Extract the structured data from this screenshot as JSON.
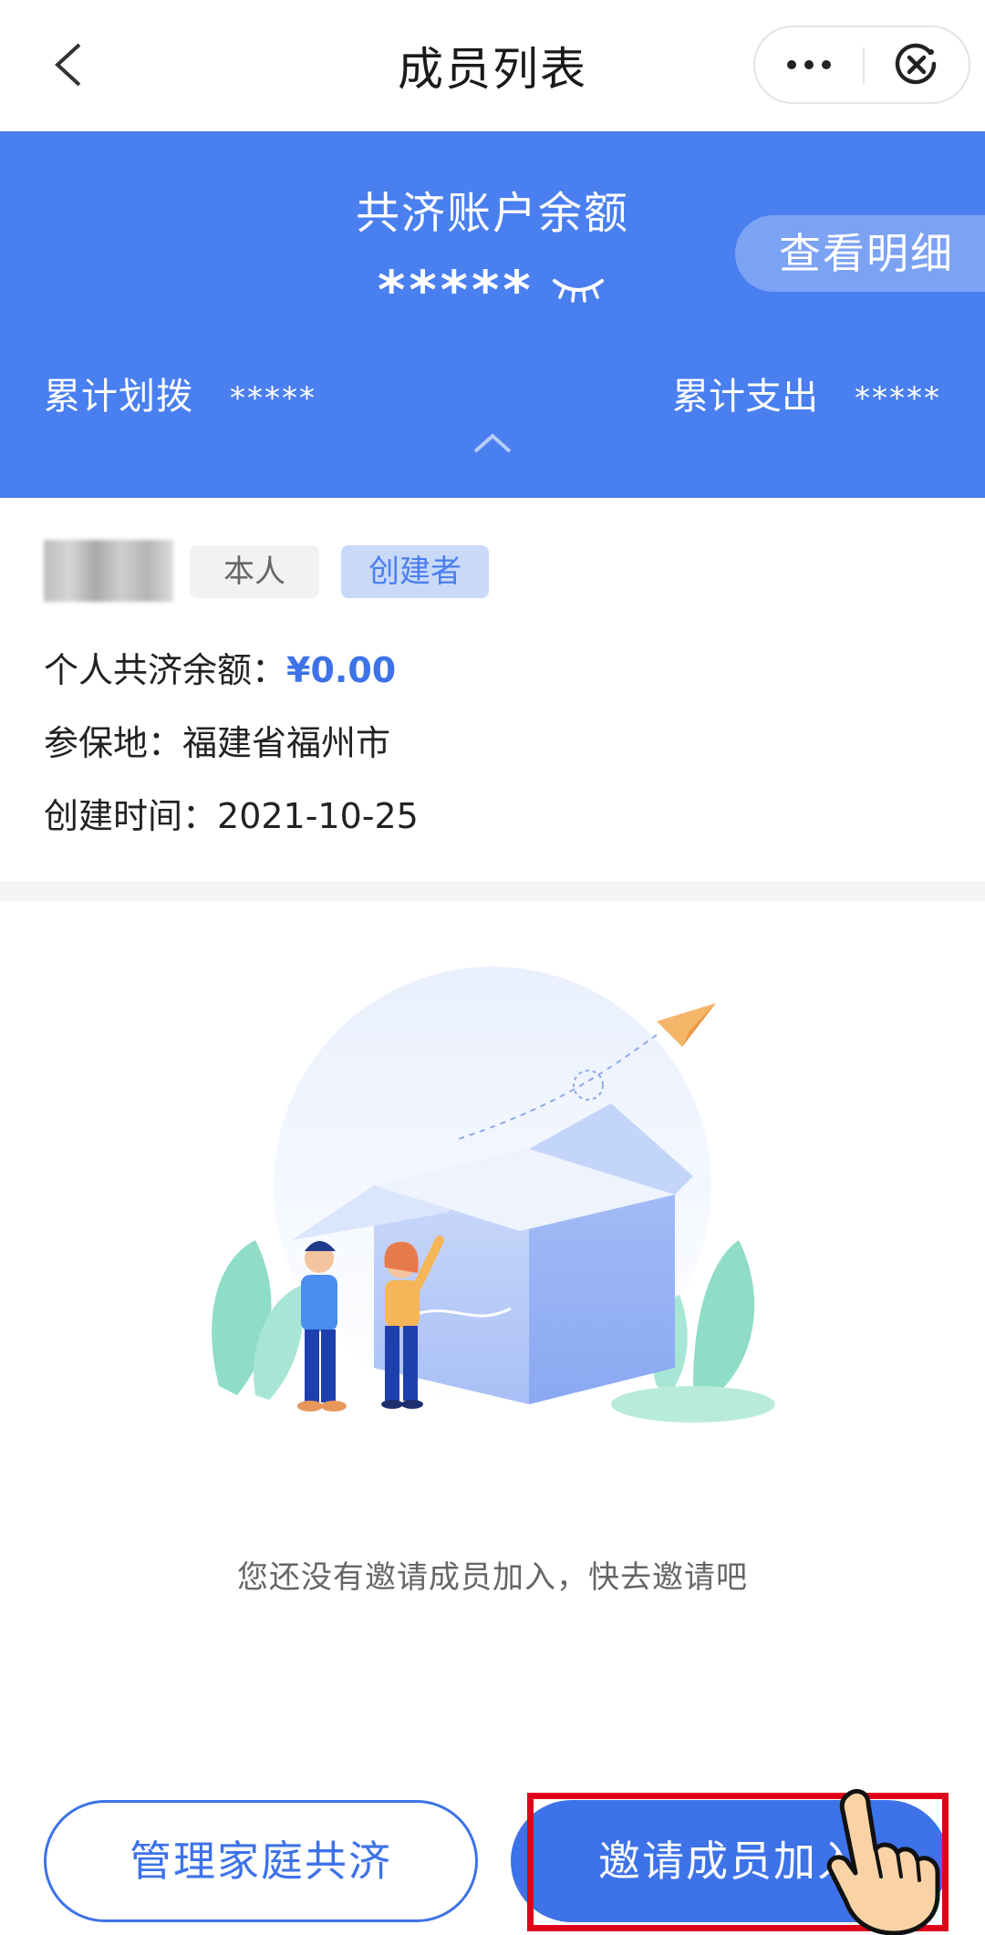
{
  "navbar": {
    "title": "成员列表",
    "back_icon": "chevron-left-icon",
    "more_icon": "more-dots-icon",
    "close_icon": "close-circle-icon"
  },
  "balance": {
    "title": "共济账户余额",
    "value": "*****",
    "eye_icon": "eye-closed-icon",
    "detail_button": "查看明细",
    "allocated_label": "累计划拨",
    "allocated_value": "*****",
    "spent_label": "累计支出",
    "spent_value": "*****",
    "collapse_icon": "chevron-up-icon",
    "card_color": "#4a7ff0"
  },
  "member": {
    "tag_self": "本人",
    "tag_creator": "创建者",
    "balance_label": "个人共济余额：",
    "balance_value": "¥0.00",
    "location_label": "参保地：",
    "location_value": "福建省福州市",
    "created_label": "创建时间：",
    "created_value": "2021-10-25"
  },
  "empty_state": {
    "message": "您还没有邀请成员加入，快去邀请吧"
  },
  "actions": {
    "manage_label": "管理家庭共济",
    "invite_label": "邀请成员加入",
    "accent_color": "#3d72e8",
    "highlight_color": "#e0001b"
  }
}
